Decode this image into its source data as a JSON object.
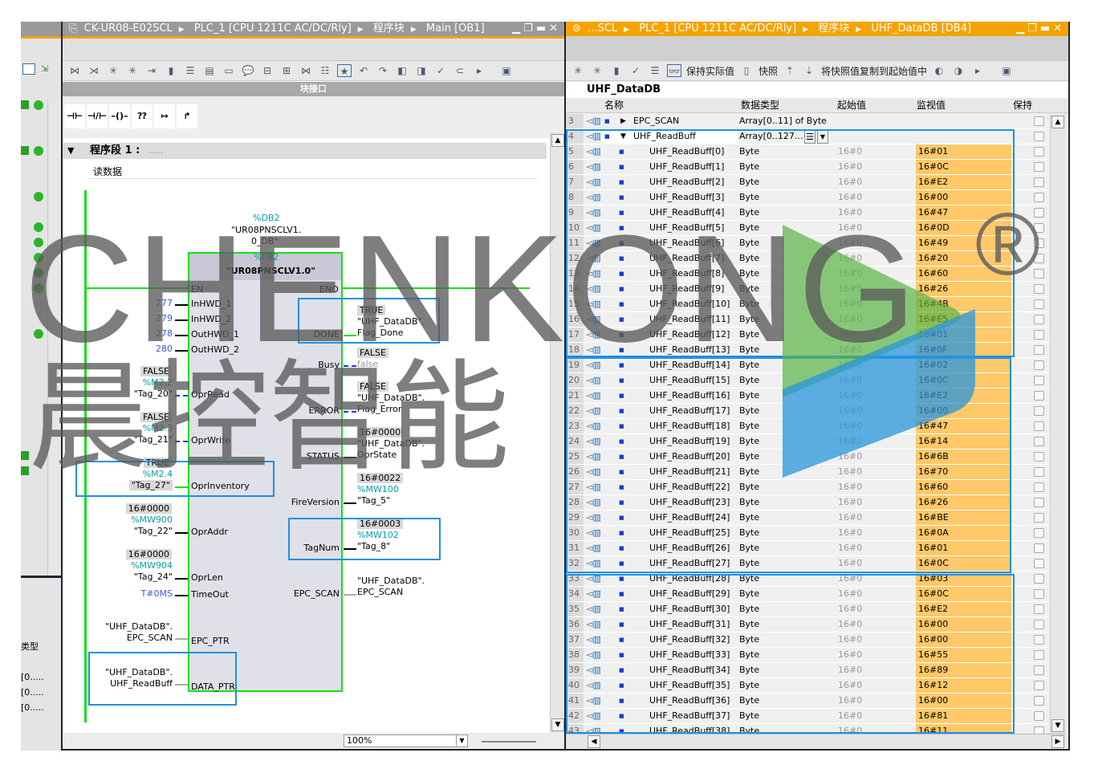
{
  "left_window": {
    "breadcrumb": [
      "CK-UR08-E02SCL",
      "PLC_1 [CPU 1211C AC/DC/Rly]",
      "程序块",
      "Main [OB1]"
    ],
    "interface_bar": "块接口",
    "network_title": "程序段 1 :",
    "network_dots": ".....",
    "network_comment": "读数据",
    "zoom": "100%",
    "fb": {
      "instance_db": "%DB2",
      "instance_name1": "\"UR08PNSCLV1.",
      "instance_name2": "0_DB\"",
      "fb_number": "%FB2",
      "fb_name": "\"UR08PNSCLV1.0\"",
      "en": "EN",
      "eno": "ENO",
      "inputs": {
        "inhwd1": {
          "pin": "InHWD_1",
          "value": "277"
        },
        "inhwd2": {
          "pin": "InHWD_2",
          "value": "279"
        },
        "outhwd1": {
          "pin": "OutHWD_1",
          "value": "278"
        },
        "outhwd2": {
          "pin": "OutHWD_2",
          "value": "280"
        },
        "oprread": {
          "pin": "OprRead",
          "state": "FALSE",
          "addr": "%M2.2",
          "tag": "\"Tag_20\""
        },
        "oprwrite": {
          "pin": "OprWrite",
          "state": "FALSE",
          "addr": "%M2.3",
          "tag": "\"Tag_21\""
        },
        "oprinv": {
          "pin": "OprInventory",
          "state": "TRUE",
          "addr": "%M2.4",
          "tag": "\"Tag_27\""
        },
        "opraddr": {
          "pin": "OprAddr",
          "state": "16#0000",
          "addr": "%MW900",
          "tag": "\"Tag_22\""
        },
        "oprlen": {
          "pin": "OprLen",
          "state": "16#0000",
          "addr": "%MW904",
          "tag": "\"Tag_24\""
        },
        "timeout": {
          "pin": "TimeOut",
          "value": "T#0MS"
        },
        "epcptr": {
          "pin": "EPC_PTR",
          "l1": "\"UHF_DataDB\".",
          "l2": "EPC_SCAN"
        },
        "dataptr": {
          "pin": "DATA_PTR",
          "l1": "\"UHF_DataDB\".",
          "l2": "UHF_ReadBuff"
        }
      },
      "outputs": {
        "done": {
          "pin": "DONE",
          "state": "TRUE",
          "l1": "\"UHF_DataDB\".",
          "l2": "Flag_Done"
        },
        "busy": {
          "pin": "Busy",
          "state": "FALSE",
          "l2": "false"
        },
        "error": {
          "pin": "ERROR",
          "state": "FALSE",
          "l1": "\"UHF_DataDB\".",
          "l2": "Flag_Error"
        },
        "status": {
          "pin": "STATUS",
          "state": "16#0000",
          "l1": "\"UHF_DataDB\".",
          "l2": "OprState"
        },
        "firever": {
          "pin": "FireVersion",
          "state": "16#0022",
          "addr": "%MW100",
          "tag": "\"Tag_5\""
        },
        "tagnum": {
          "pin": "TagNum",
          "state": "16#0003",
          "addr": "%MW102",
          "tag": "\"Tag_8\""
        },
        "epcscan": {
          "pin": "EPC_SCAN",
          "l1": "\"UHF_DataDB\".",
          "l2": "EPC_SCAN"
        }
      }
    },
    "side": {
      "type_header": "类型",
      "items": [
        "[0.....",
        "[0.....",
        "[0....."
      ]
    }
  },
  "right_window": {
    "breadcrumb": [
      "...SCL",
      "PLC_1 [CPU 1211C AC/DC/Rly]",
      "程序块",
      "UHF_DataDB [DB4]"
    ],
    "toolbar": {
      "keep_actual": "保持实际值",
      "snapshot": "快照",
      "copy_snapshot": "将快照值复制到起始值中"
    },
    "db_title": "UHF_DataDB",
    "columns": {
      "name": "名称",
      "type": "数据类型",
      "start": "起始值",
      "monitor": "监视值",
      "retain": "保持"
    },
    "rows_static": [
      {
        "no": "3",
        "name": "EPC_SCAN",
        "type": "Array[0..11] of Byte"
      },
      {
        "no": "4",
        "name": "UHF_ReadBuff",
        "type": "Array[0..127..."
      }
    ],
    "elem_type": "Byte",
    "elem_start": "16#0",
    "monitor_values": [
      "16#01",
      "16#0C",
      "16#E2",
      "16#00",
      "16#47",
      "16#0D",
      "16#49",
      "16#20",
      "16#60",
      "16#26",
      "16#4B",
      "16#E5",
      "16#01",
      "16#0F",
      "16#02",
      "16#0C",
      "16#E2",
      "16#00",
      "16#47",
      "16#14",
      "16#6B",
      "16#70",
      "16#60",
      "16#26",
      "16#BE",
      "16#0A",
      "16#01",
      "16#0C",
      "16#03",
      "16#0C",
      "16#E2",
      "16#00",
      "16#00",
      "16#55",
      "16#89",
      "16#12",
      "16#00",
      "16#81",
      "16#11"
    ]
  },
  "watermark": {
    "latin": "CHENKONG",
    "chinese": "晨控智能",
    "reg": "®"
  },
  "colors": {
    "accent": "#f5a300",
    "wire_on": "#16e016",
    "monitor": "#ffc869",
    "select": "#1e90e8"
  }
}
